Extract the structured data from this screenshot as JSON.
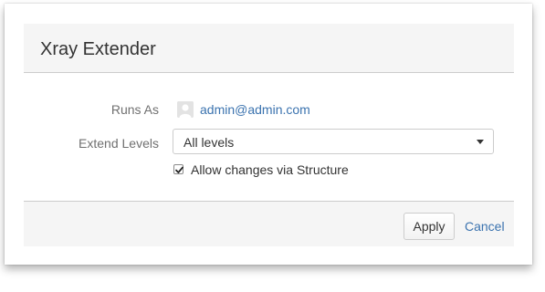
{
  "dialog": {
    "title": "Xray Extender"
  },
  "form": {
    "runs_as_label": "Runs As",
    "runs_as_user": "admin@admin.com",
    "extend_levels_label": "Extend Levels",
    "extend_levels_value": "All levels",
    "allow_changes_label": "Allow changes via Structure",
    "allow_changes_checked": true
  },
  "footer": {
    "apply_label": "Apply",
    "cancel_label": "Cancel"
  },
  "colors": {
    "link": "#3b73af",
    "panel_bg": "#f5f5f5",
    "border": "#cccccc"
  },
  "icons": {
    "avatar": "user-avatar-icon",
    "dropdown": "chevron-down-icon",
    "checkbox": "checkmark-icon"
  }
}
